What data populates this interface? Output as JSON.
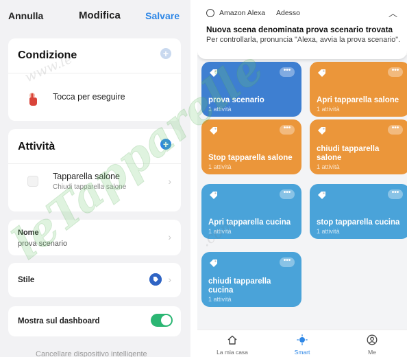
{
  "left_panel": {
    "header": {
      "cancel": "Annulla",
      "title": "Modifica",
      "save": "Salvare"
    },
    "condition": {
      "title": "Condizione",
      "item_label": "Tocca per eseguire",
      "add_icon": "plus-icon"
    },
    "activity": {
      "title": "Attività",
      "device_name": "Tapparella salone",
      "device_action": "Chiudi tapparella salone",
      "add_icon": "plus-icon"
    },
    "name_row": {
      "label": "Nome",
      "value": "prova scenario"
    },
    "style_row": {
      "label": "Stile",
      "icon": "tag-icon"
    },
    "dashboard_row": {
      "label": "Mostra sul dashboard",
      "toggle_on": true
    },
    "delete_label": "Cancellare dispositivo intelligente"
  },
  "right_panel": {
    "notification": {
      "app": "Amazon Alexa",
      "time": "Adesso",
      "title": "Nuova scena denominata prova scenario trovata",
      "body": "Per controllarla, pronuncia \"Alexa, avvia la prova scenario\"."
    },
    "scenes": [
      {
        "name": "prova scenario",
        "count": "1 attività",
        "color": "#3e7fd1"
      },
      {
        "name": "Apri tapparella salone",
        "count": "1 attività",
        "color": "#eb963a"
      },
      {
        "name": "Stop tapparella salone",
        "count": "1 attività",
        "color": "#eb963a"
      },
      {
        "name": "chiudi tapparella salone",
        "count": "1 attività",
        "color": "#eb963a"
      },
      {
        "name": "Apri tapparella cucina",
        "count": "1 attività",
        "color": "#4aa3d9"
      },
      {
        "name": "stop tapparella cucina",
        "count": "1 attività",
        "color": "#4aa3d9"
      },
      {
        "name": "chiudi tapparella cucina",
        "count": "1 attività",
        "color": "#4aa3d9"
      }
    ],
    "more_label": "•••",
    "tabs": [
      {
        "label": "La mia casa",
        "icon": "home-icon",
        "active": false
      },
      {
        "label": "Smart",
        "icon": "sun-icon",
        "active": true
      },
      {
        "label": "Me",
        "icon": "user-icon",
        "active": false
      }
    ]
  },
  "watermark": {
    "text": "www.letapparelle.com"
  },
  "colors": {
    "accent": "#2e87e6",
    "toggle": "#2bb673",
    "orange": "#eb963a",
    "sky": "#4aa3d9",
    "blue": "#3e7fd1"
  }
}
